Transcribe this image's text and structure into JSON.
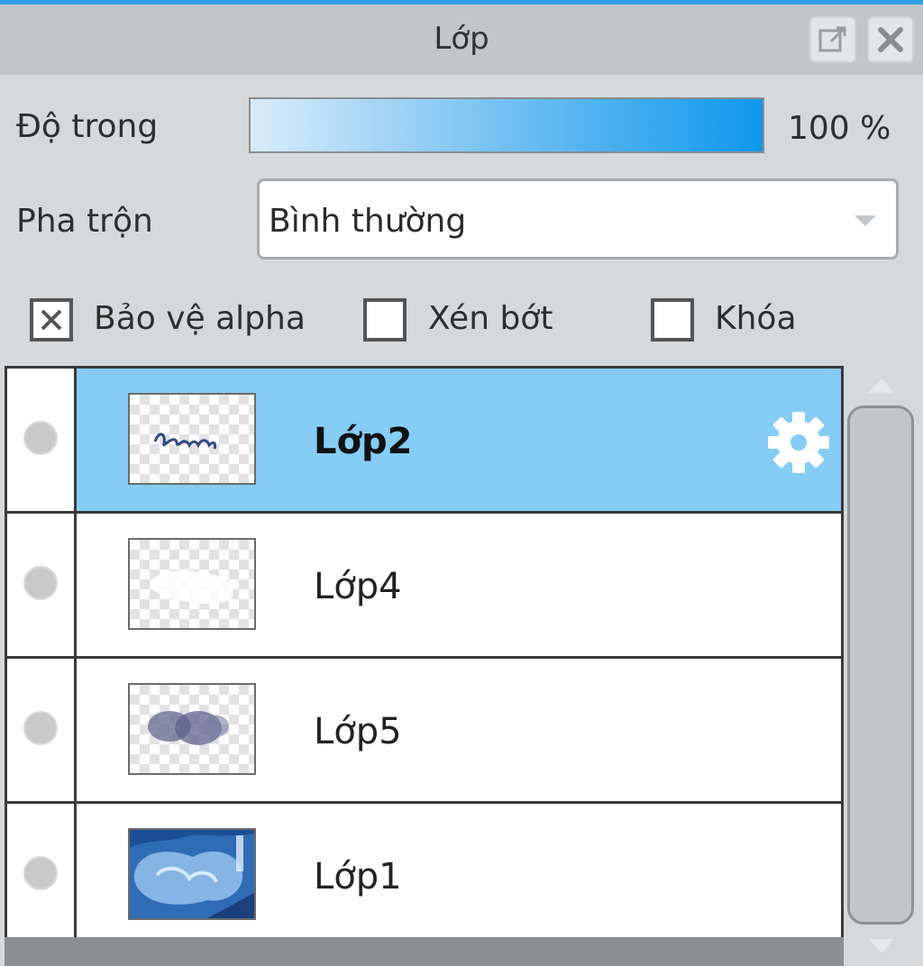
{
  "panel": {
    "title": "Lớp",
    "popout_icon": "popout-icon",
    "close_icon": "close-icon"
  },
  "opacity": {
    "label": "Độ trong",
    "value_text": "100 %",
    "value": 100
  },
  "blend": {
    "label": "Pha trộn",
    "selected": "Bình thường"
  },
  "options": {
    "protect_alpha": {
      "label": "Bảo vệ alpha",
      "checked": true
    },
    "clipping": {
      "label": "Xén bớt",
      "checked": false
    },
    "lock": {
      "label": "Khóa",
      "checked": false
    }
  },
  "layers": [
    {
      "name": "Lớp2",
      "selected": true,
      "thumb": "text-drawing"
    },
    {
      "name": "Lớp4",
      "selected": false,
      "thumb": "white-shape"
    },
    {
      "name": "Lớp5",
      "selected": false,
      "thumb": "grey-blur"
    },
    {
      "name": "Lớp1",
      "selected": false,
      "thumb": "blue-image"
    }
  ],
  "colors": {
    "accent": "#2e9fe6",
    "selection": "#84cdf6"
  }
}
